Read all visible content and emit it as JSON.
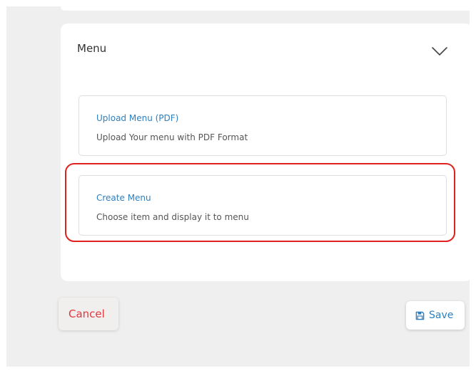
{
  "panel": {
    "title": "Menu",
    "toggle_icon": "chevron-down-icon"
  },
  "options": [
    {
      "title": "Upload Menu (PDF)",
      "description": "Upload Your menu with PDF Format"
    },
    {
      "title": "Create Menu",
      "description": "Choose item and display it to menu",
      "highlighted": true
    }
  ],
  "actions": {
    "cancel_label": "Cancel",
    "save_label": "Save",
    "save_icon": "floppy-disk-icon"
  },
  "colors": {
    "accent": "#2d7fc0",
    "danger": "#e0383b",
    "highlight": "#e0201f",
    "background": "#efefef"
  }
}
